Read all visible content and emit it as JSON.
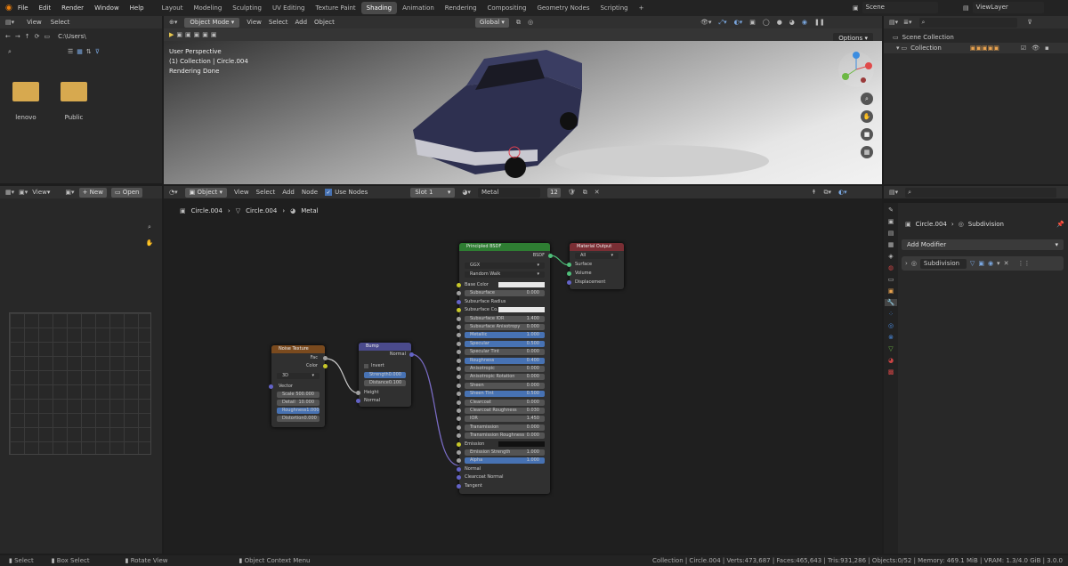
{
  "menu": {
    "file": "File",
    "edit": "Edit",
    "render": "Render",
    "window": "Window",
    "help": "Help"
  },
  "workspaces": [
    "Layout",
    "Modeling",
    "Sculpting",
    "UV Editing",
    "Texture Paint",
    "Shading",
    "Animation",
    "Rendering",
    "Compositing",
    "Geometry Nodes",
    "Scripting"
  ],
  "active_workspace": "Shading",
  "scene": "Scene",
  "view_layer": "ViewLayer",
  "file_browser": {
    "view": "View",
    "select": "Select",
    "path": "C:\\Users\\",
    "folders": [
      "lenovo",
      "Public"
    ]
  },
  "viewport": {
    "mode": "Object Mode",
    "view": "View",
    "select": "Select",
    "add": "Add",
    "object": "Object",
    "orientation": "Global",
    "options": "Options",
    "info": [
      "User Perspective",
      "(1) Collection | Circle.004",
      "Rendering Done"
    ]
  },
  "outliner": {
    "scene_collection": "Scene Collection",
    "collection": "Collection"
  },
  "image_editor": {
    "view": "View",
    "new": "New",
    "open": "Open"
  },
  "node_editor": {
    "object": "Object",
    "view": "View",
    "select": "Select",
    "add": "Add",
    "node": "Node",
    "use_nodes": "Use Nodes",
    "slot": "Slot 1",
    "material": "Metal",
    "users": "12",
    "breadcrumb": [
      "Circle.004",
      "Circle.004",
      "Metal"
    ]
  },
  "properties": {
    "object": "Circle.004",
    "modifier": "Subdivision",
    "add_modifier": "Add Modifier",
    "modifier_name": "Subdivision"
  },
  "nodes": {
    "principled": {
      "title": "Principled BSDF",
      "out": "BSDF",
      "dist": "GGX",
      "sss": "Random Walk",
      "rows": [
        [
          "Base Color",
          ""
        ],
        [
          "Subsurface",
          "0.000"
        ],
        [
          "Subsurface Radius",
          ""
        ],
        [
          "Subsurface Co...",
          ""
        ],
        [
          "Subsurface IOR",
          "1.400"
        ],
        [
          "Subsurface Anisotropy",
          "0.000"
        ],
        [
          "Metallic",
          "1.000"
        ],
        [
          "Specular",
          "0.500"
        ],
        [
          "Specular Tint",
          "0.000"
        ],
        [
          "Roughness",
          "0.400"
        ],
        [
          "Anisotropic",
          "0.000"
        ],
        [
          "Anisotropic Rotation",
          "0.000"
        ],
        [
          "Sheen",
          "0.000"
        ],
        [
          "Sheen Tint",
          "0.500"
        ],
        [
          "Clearcoat",
          "0.000"
        ],
        [
          "Clearcoat Roughness",
          "0.030"
        ],
        [
          "IOR",
          "1.450"
        ],
        [
          "Transmission",
          "0.000"
        ],
        [
          "Transmission Roughness",
          "0.000"
        ],
        [
          "Emission",
          ""
        ],
        [
          "Emission Strength",
          "1.000"
        ],
        [
          "Alpha",
          "1.000"
        ],
        [
          "Normal",
          ""
        ],
        [
          "Clearcoat Normal",
          ""
        ],
        [
          "Tangent",
          ""
        ]
      ]
    },
    "output": {
      "title": "Material Output",
      "target": "All",
      "inputs": [
        "Surface",
        "Volume",
        "Displacement"
      ]
    },
    "noise": {
      "title": "Noise Texture",
      "outs": [
        "Fac",
        "Color"
      ],
      "dim": "3D",
      "vector": "Vector",
      "rows": [
        [
          "Scale",
          "500.000"
        ],
        [
          "Detail",
          "10.000"
        ],
        [
          "Roughness",
          "1.000"
        ],
        [
          "Distortion",
          "0.000"
        ]
      ]
    },
    "bump": {
      "title": "Bump",
      "out": "Normal",
      "invert": "Invert",
      "rows": [
        [
          "Strength",
          "0.000"
        ],
        [
          "Distance",
          "0.100"
        ]
      ],
      "inputs": [
        "Height",
        "Normal"
      ]
    }
  },
  "status": {
    "select": "Select",
    "box": "Box Select",
    "rotate": "Rotate View",
    "context": "Object Context Menu",
    "stats": "Collection | Circle.004 | Verts:473,687 | Faces:465,643 | Tris:931,286 | Objects:0/52 | Memory: 469.1 MiB | VRAM: 1.3/4.0 GiB | 3.0.0"
  }
}
